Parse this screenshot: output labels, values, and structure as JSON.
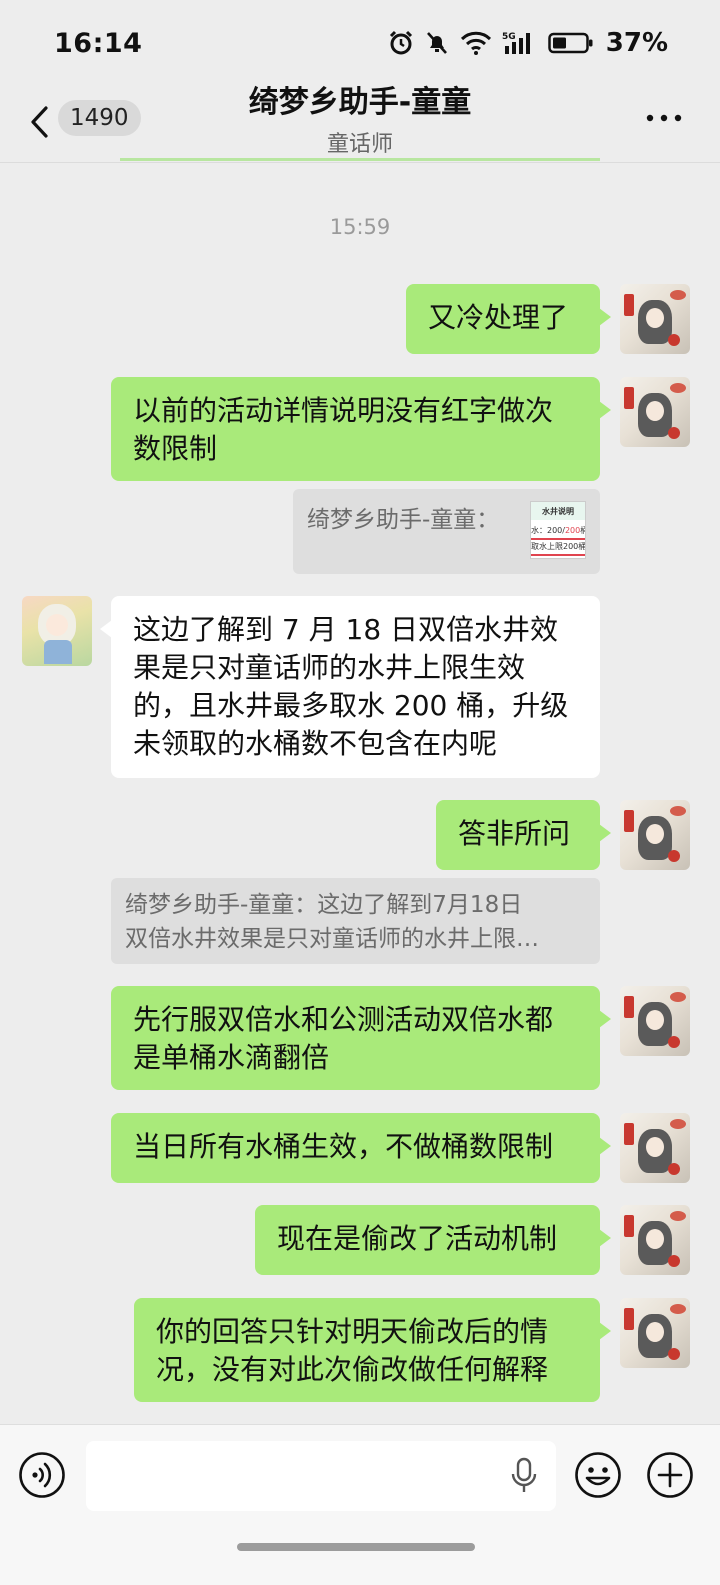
{
  "status_bar": {
    "time": "16:14",
    "battery_percent": "37%",
    "network": "5G"
  },
  "header": {
    "unread_count": "1490",
    "title": "绮梦乡助手-童童",
    "subtitle": "童话师"
  },
  "chat": {
    "time_divider": "15:59",
    "messages": [
      {
        "side": "out",
        "text": "又冷处理了"
      },
      {
        "side": "out",
        "text_lines": [
          "以前的活动详情说明没有红字做次",
          "数限制"
        ]
      },
      {
        "side": "quote",
        "text": "绮梦乡助手-童童：",
        "thumbnail": {
          "title": "水井说明",
          "line1_prefix": "水：200/",
          "line1_red": "200",
          "line1_suffix": "桶",
          "line2": "取水上限200桶"
        }
      },
      {
        "side": "in",
        "text_lines": [
          "这边了解到 7 月 18 日双倍水井效",
          "果是只对童话师的水井上限生效",
          "的，且水井最多取水 200 桶，升级",
          "未领取的水桶数不包含在内呢"
        ]
      },
      {
        "side": "out",
        "text": "答非所问"
      },
      {
        "side": "quote",
        "text_lines": [
          "绮梦乡助手-童童：这边了解到7月18日",
          "双倍水井效果是只对童话师的水井上限…"
        ]
      },
      {
        "side": "out",
        "text_lines": [
          "先行服双倍水和公测活动双倍水都",
          "是单桶水滴翻倍"
        ]
      },
      {
        "side": "out",
        "text": "当日所有水桶生效，不做桶数限制"
      },
      {
        "side": "out",
        "text": "现在是偷改了活动机制"
      },
      {
        "side": "out",
        "text_lines": [
          "你的回答只针对明天偷改后的情",
          "况，没有对此次偷改做任何解释"
        ]
      }
    ]
  },
  "input_bar": {
    "voice_icon": "voice-mode-icon",
    "mic_icon": "microphone-icon",
    "emoji_icon": "emoji-icon",
    "more_icon": "plus-icon"
  },
  "colors": {
    "outgoing_bubble": "#a9ea7a",
    "incoming_bubble": "#ffffff",
    "background": "#ededed",
    "quote_bg": "#dedede"
  }
}
